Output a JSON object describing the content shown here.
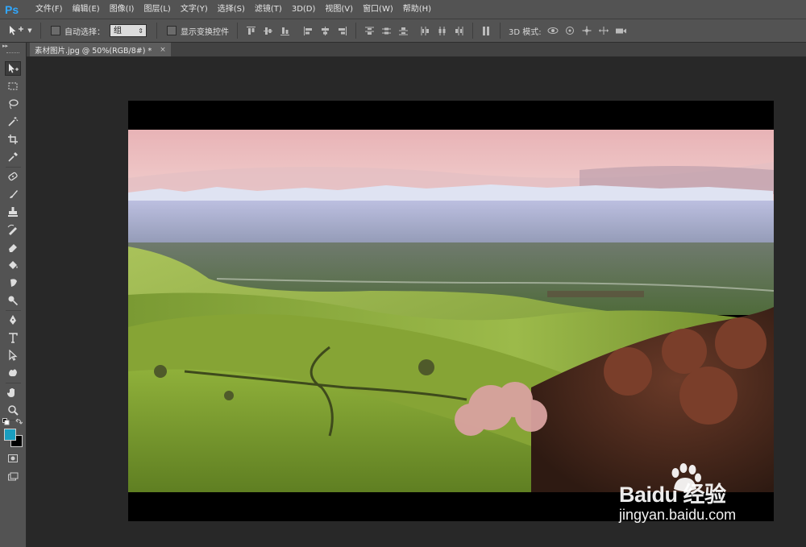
{
  "app": {
    "logo": "Ps"
  },
  "menu": [
    "文件(F)",
    "编辑(E)",
    "图像(I)",
    "图层(L)",
    "文字(Y)",
    "选择(S)",
    "滤镜(T)",
    "3D(D)",
    "视图(V)",
    "窗口(W)",
    "帮助(H)"
  ],
  "options": {
    "auto_select_label": "自动选择：",
    "group_value": "组",
    "show_transform_label": "显示变换控件",
    "mode3d_label": "3D 模式:"
  },
  "document": {
    "tab_title": "素材图片.jpg @ 50%(RGB/8#) *",
    "close_symbol": "×"
  },
  "colors": {
    "foreground": "#1a9ec0",
    "background": "#000000",
    "ui_panel": "#535353",
    "workspace": "#282828"
  },
  "watermark": {
    "brand": "Baidu 经验",
    "url": "jingyan.baidu.com"
  }
}
